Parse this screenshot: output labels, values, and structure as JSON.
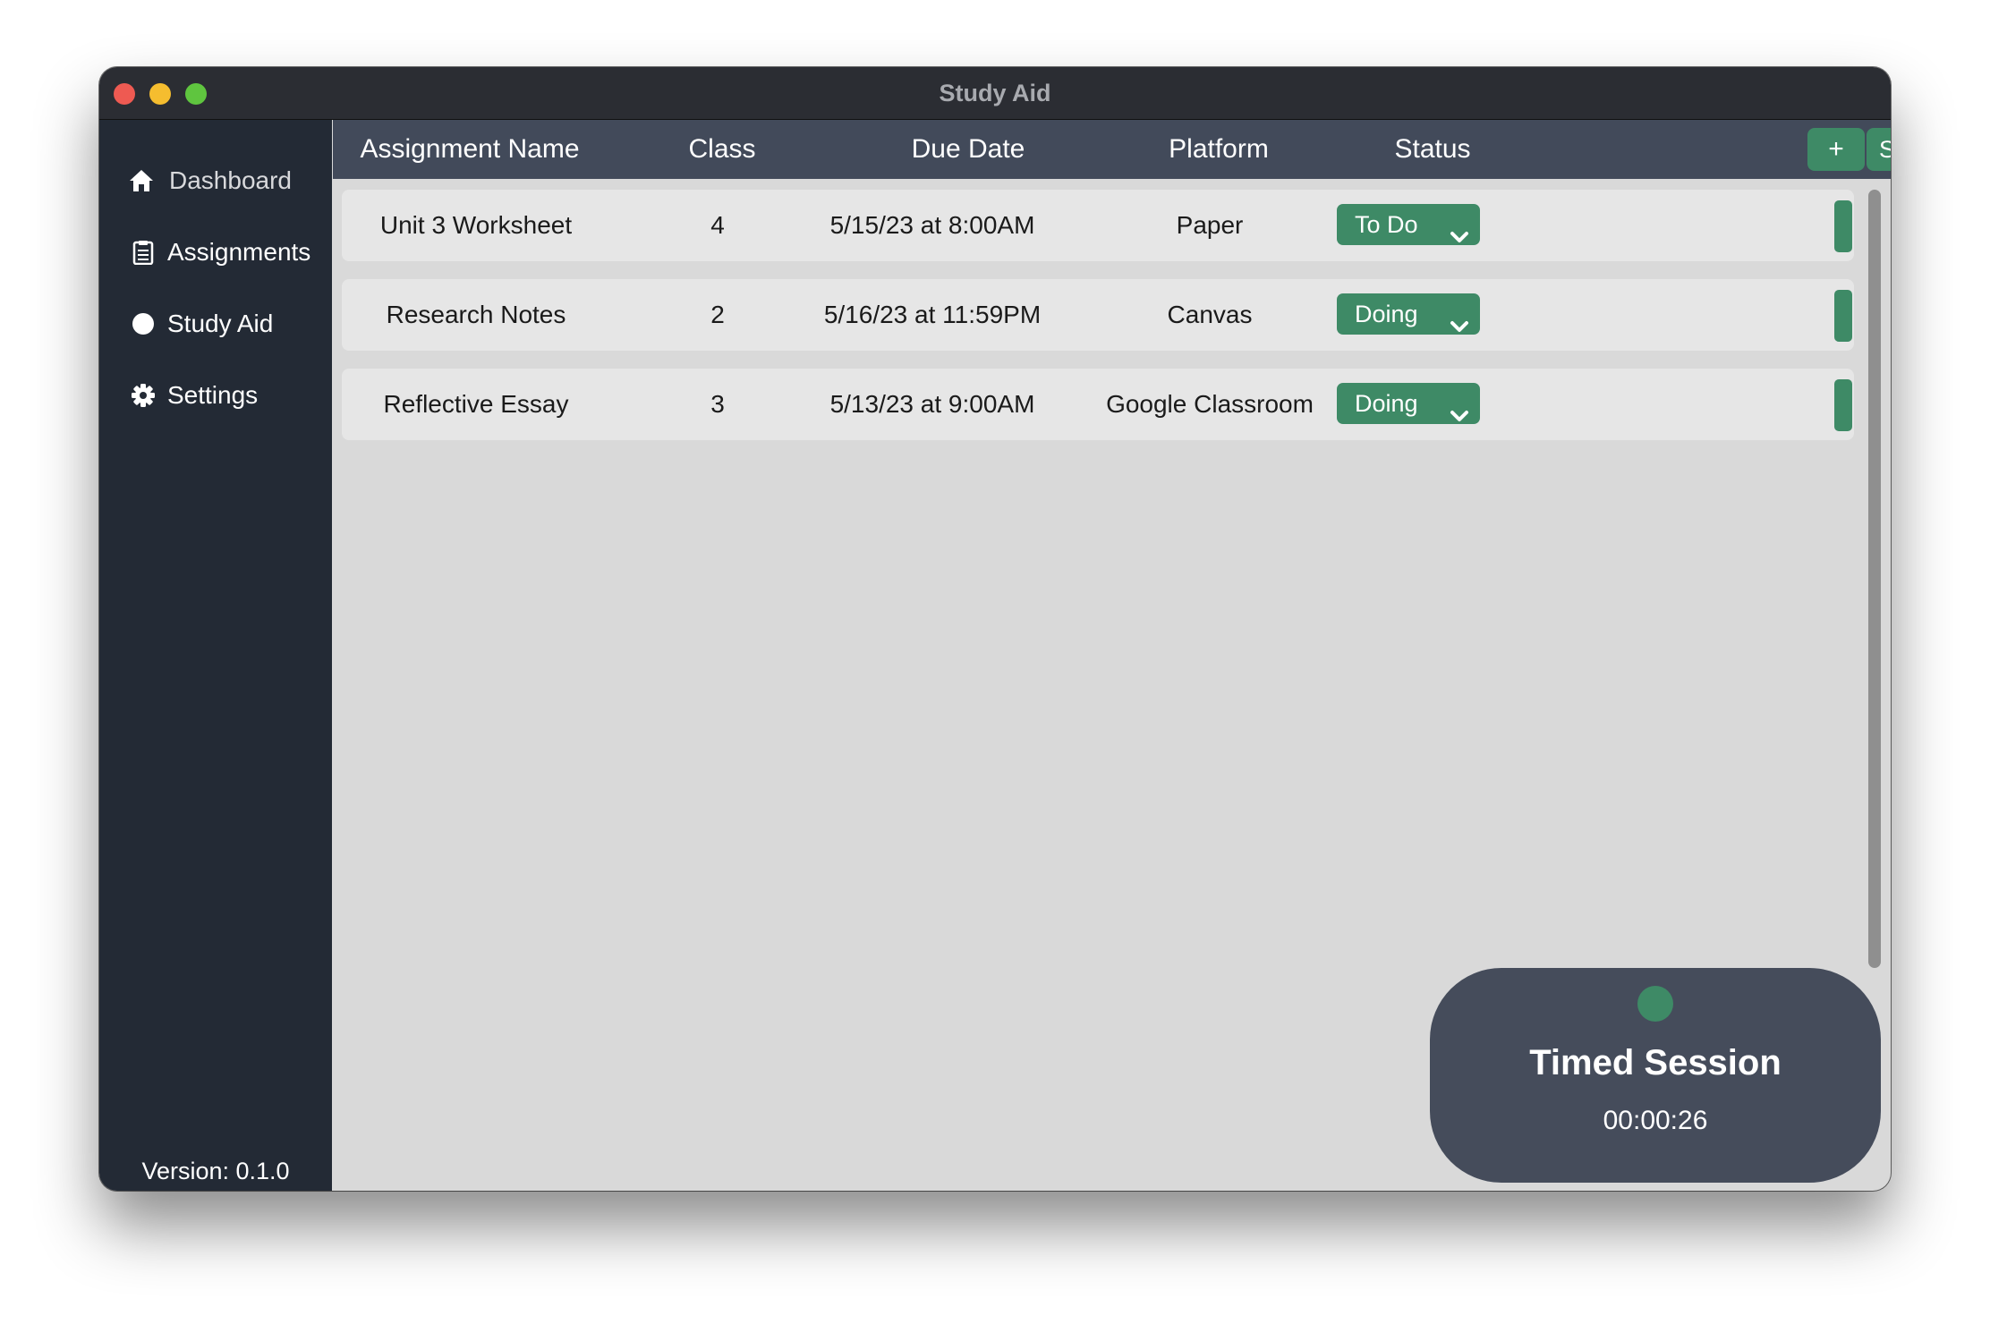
{
  "window": {
    "title": "Study Aid"
  },
  "sidebar": {
    "items": [
      {
        "label": "Dashboard",
        "icon": "home-icon"
      },
      {
        "label": "Assignments",
        "icon": "clipboard-icon"
      },
      {
        "label": "Study Aid",
        "icon": "circle-icon"
      },
      {
        "label": "Settings",
        "icon": "gear-icon"
      }
    ],
    "version": "Version: 0.1.0"
  },
  "table": {
    "headers": [
      "Assignment Name",
      "Class",
      "Due Date",
      "Platform",
      "Status"
    ],
    "add_label": "+",
    "sort_label": "Sort By: Due Date",
    "rows": [
      {
        "name": "Unit 3 Worksheet",
        "class": "4",
        "due": "5/15/23 at 8:00AM",
        "platform": "Paper",
        "status": "To Do"
      },
      {
        "name": "Research Notes",
        "class": "2",
        "due": "5/16/23 at 11:59PM",
        "platform": "Canvas",
        "status": "Doing"
      },
      {
        "name": "Reflective Essay",
        "class": "3",
        "due": "5/13/23 at 9:00AM",
        "platform": "Google Classroom",
        "status": "Doing"
      }
    ]
  },
  "timer": {
    "title": "Timed Session",
    "time": "00:00:26"
  },
  "colors": {
    "accent": "#3e8a66",
    "sidebar_bg": "#232a35",
    "header_bg": "#424a5a",
    "content_bg": "#d9d9d9",
    "row_bg": "#e6e6e6"
  }
}
